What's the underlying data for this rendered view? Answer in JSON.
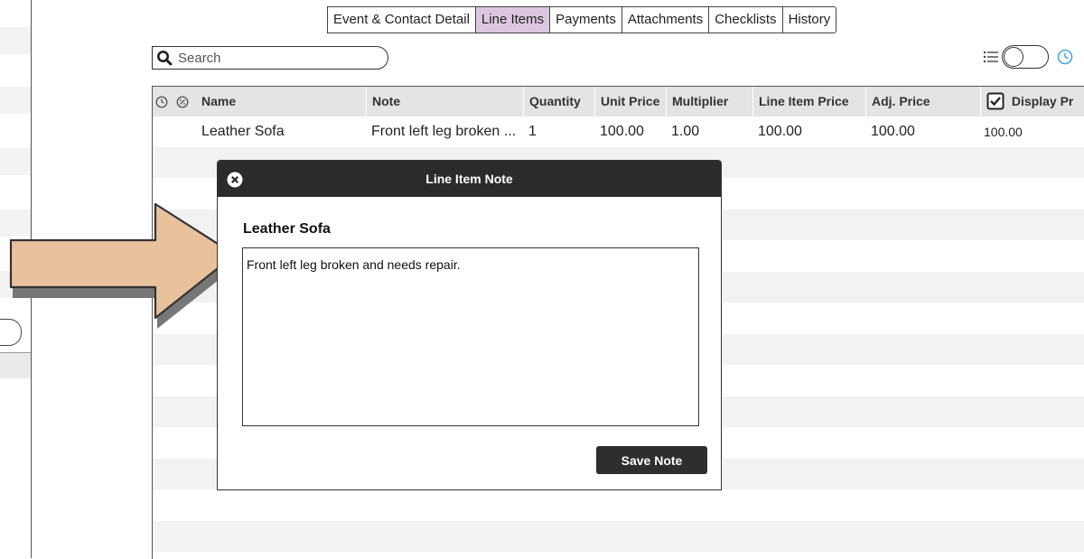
{
  "tabs": [
    {
      "label": "Event & Contact Detail",
      "active": false
    },
    {
      "label": "Line Items",
      "active": true
    },
    {
      "label": "Payments",
      "active": false
    },
    {
      "label": "Attachments",
      "active": false
    },
    {
      "label": "Checklists",
      "active": false
    },
    {
      "label": "History",
      "active": false
    }
  ],
  "search": {
    "placeholder": "Search",
    "icon": "search-icon"
  },
  "toolbar": {
    "list_icon": "list-view-icon",
    "toggle_state": "off",
    "clock_icon": "clock-icon",
    "clock_color": "#4aa8e0"
  },
  "table": {
    "columns": [
      "Name",
      "Note",
      "Quantity",
      "Unit Price",
      "Multiplier",
      "Line Item Price",
      "Adj. Price",
      "Display Pr"
    ],
    "header_icons": [
      "clock-icon",
      "tag-icon"
    ],
    "display_price_checked": true,
    "rows": [
      {
        "name": "Leather Sofa",
        "note": "Front left leg broken ...",
        "quantity": "1",
        "unit_price": "100.00",
        "multiplier": "1.00",
        "line_item_price": "100.00",
        "adj_price": "100.00",
        "display_price": "100.00"
      }
    ]
  },
  "modal": {
    "title": "Line Item Note",
    "item_name": "Leather Sofa",
    "note_text": "Front left leg broken and needs repair. ",
    "save_label": "Save Note",
    "close_icon": "close-icon"
  },
  "colors": {
    "active_tab": "#dcc7e0",
    "arrow_fill": "#e8c19d",
    "modal_header": "#2b2b2b",
    "header_bg": "#e4e4e4"
  }
}
